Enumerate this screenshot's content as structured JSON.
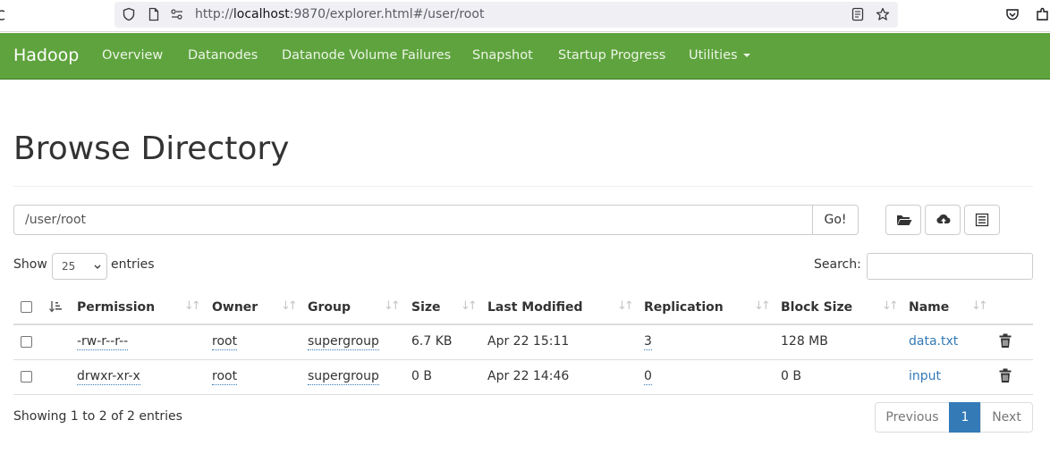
{
  "browser": {
    "url_prefix": "http://",
    "url_host": "localhost",
    "url_rest": ":9870/explorer.html#/user/root"
  },
  "navbar": {
    "brand": "Hadoop",
    "items": [
      "Overview",
      "Datanodes",
      "Datanode Volume Failures",
      "Snapshot",
      "Startup Progress",
      "Utilities"
    ],
    "color": "#5fa33e"
  },
  "page": {
    "title": "Browse Directory"
  },
  "path": {
    "value": "/user/root",
    "go_label": "Go!"
  },
  "toolbar": {
    "icons": [
      "folder-open-icon",
      "cloud-upload-icon",
      "list-icon"
    ]
  },
  "entries": {
    "show_label": "Show",
    "selected": "25",
    "suffix": "entries",
    "search_label": "Search:"
  },
  "table": {
    "headers": [
      "Permission",
      "Owner",
      "Group",
      "Size",
      "Last Modified",
      "Replication",
      "Block Size",
      "Name"
    ],
    "rows": [
      {
        "permission": "-rw-r--r--",
        "owner": "root",
        "group": "supergroup",
        "size": "6.7 KB",
        "modified": "Apr 22 15:11",
        "replication": "3",
        "block_size": "128 MB",
        "name": "data.txt"
      },
      {
        "permission": "drwxr-xr-x",
        "owner": "root",
        "group": "supergroup",
        "size": "0 B",
        "modified": "Apr 22 14:46",
        "replication": "0",
        "block_size": "0 B",
        "name": "input"
      }
    ]
  },
  "footer": {
    "info": "Showing 1 to 2 of 2 entries",
    "previous": "Previous",
    "current_page": "1",
    "next": "Next"
  }
}
